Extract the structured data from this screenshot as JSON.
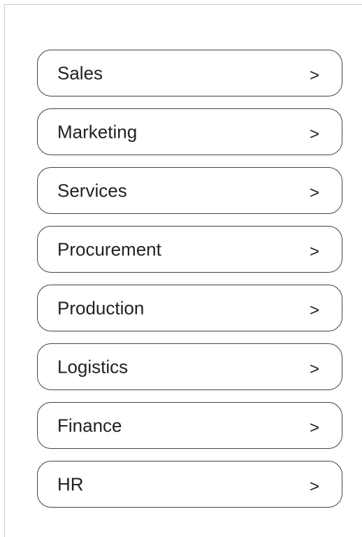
{
  "menu": {
    "chevron_glyph": ">",
    "items": [
      {
        "label": "Sales"
      },
      {
        "label": "Marketing"
      },
      {
        "label": "Services"
      },
      {
        "label": "Procurement"
      },
      {
        "label": "Production"
      },
      {
        "label": "Logistics"
      },
      {
        "label": "Finance"
      },
      {
        "label": "HR"
      }
    ]
  }
}
